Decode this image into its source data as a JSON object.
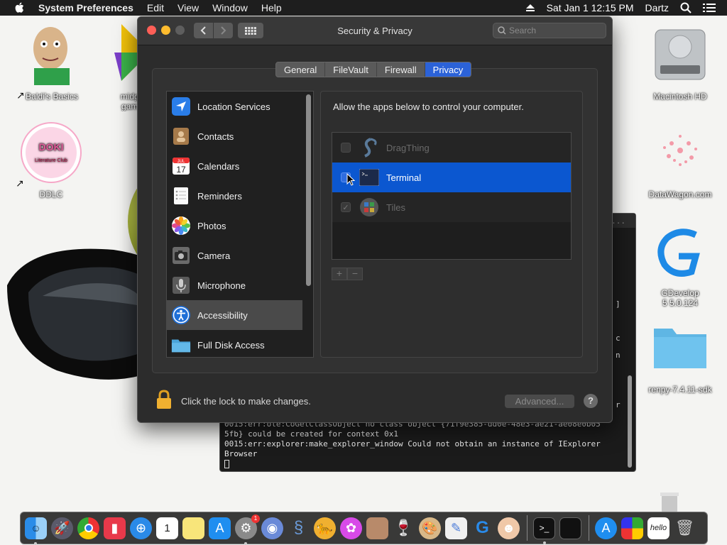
{
  "menubar": {
    "app_name": "System Preferences",
    "menus": [
      "Edit",
      "View",
      "Window",
      "Help"
    ],
    "datetime": "Sat Jan 1  12:15 PM",
    "user": "Dartz"
  },
  "desktop": {
    "left_icons": [
      {
        "label": "Baldi's Basics"
      },
      {
        "label": "midge game"
      },
      {
        "label": "DDLC"
      }
    ],
    "right_icons": [
      {
        "label": "Macintosh HD"
      },
      {
        "label": "DataWagon.com"
      },
      {
        "label": "GDevelop 5 5.0.124"
      },
      {
        "label": "renpy-7.4.11-sdk"
      }
    ],
    "ddlc_logo_text": "Doki Doki Literature Club"
  },
  "terminal": {
    "title_fragment": "f...",
    "edge_chars": [
      "]",
      "c",
      "n",
      "r"
    ],
    "lines": [
      "0015:err:ole:CoGetClassObject no class object {71f9e385-dd0e-48e3-ae21-ae08e0b05",
      "5fb} could be created for context 0x1",
      "0015:err:explorer:make_explorer_window Could not obtain an instance of IExplorer",
      "Browser"
    ]
  },
  "window": {
    "title": "Security & Privacy",
    "search_placeholder": "Search",
    "tabs": [
      {
        "label": "General",
        "active": false
      },
      {
        "label": "FileVault",
        "active": false
      },
      {
        "label": "Firewall",
        "active": false
      },
      {
        "label": "Privacy",
        "active": true
      }
    ],
    "sidebar": [
      {
        "label": "Location Services",
        "icon": "location-arrow-icon"
      },
      {
        "label": "Contacts",
        "icon": "contacts-book-icon"
      },
      {
        "label": "Calendars",
        "icon": "calendar-icon",
        "cal_month": "JUL",
        "cal_day": "17"
      },
      {
        "label": "Reminders",
        "icon": "reminders-list-icon"
      },
      {
        "label": "Photos",
        "icon": "photos-flower-icon"
      },
      {
        "label": "Camera",
        "icon": "camera-icon"
      },
      {
        "label": "Microphone",
        "icon": "microphone-icon"
      },
      {
        "label": "Accessibility",
        "icon": "accessibility-icon",
        "selected": true
      },
      {
        "label": "Full Disk Access",
        "icon": "folder-icon"
      }
    ],
    "description": "Allow the apps below to control your computer.",
    "apps": [
      {
        "name": "DragThing",
        "checked": false,
        "selected": false
      },
      {
        "name": "Terminal",
        "checked": false,
        "selected": true
      },
      {
        "name": "Tiles",
        "checked": true,
        "selected": false
      }
    ],
    "add_label": "+",
    "remove_label": "−",
    "lock_text": "Click the lock to make changes.",
    "advanced_label": "Advanced...",
    "help_label": "?"
  },
  "dock": {
    "apps": [
      "Finder",
      "Launchpad",
      "Chrome",
      "Flashcard",
      "Safari",
      "Calendar",
      "Notes",
      "App Store",
      "System Preferences",
      "Network Radar",
      "DragThing",
      "Cheetah",
      "Flower",
      "Stickies",
      "Wine",
      "Paint",
      "TextEdit",
      "GDevelop",
      "Anime",
      "Terminal",
      "Activity",
      "App Store",
      "Tiles",
      "Hello",
      "Trash"
    ],
    "calendar_day": "1",
    "badge": "1"
  },
  "colors": {
    "accent": "#0b57d0",
    "window_bg": "#2c2c2c",
    "menubar_bg": "#1e1e1e"
  }
}
